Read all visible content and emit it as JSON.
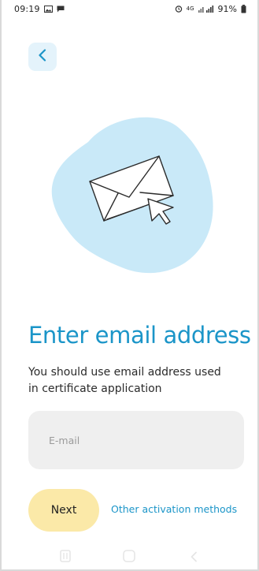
{
  "status_bar": {
    "time": "09:19",
    "battery": "91%",
    "network": "4G",
    "icons": [
      "image-icon",
      "message-icon",
      "alarm-icon",
      "signal-icon",
      "battery-icon"
    ]
  },
  "header": {
    "back_icon": "chevron-left-icon"
  },
  "illustration": {
    "name": "envelope-with-cursor",
    "blob_color": "#c9e9f8",
    "stroke_color": "#2b2b2b"
  },
  "main": {
    "title": "Enter email address",
    "subtitle": "You should use email address used in certificate application"
  },
  "form": {
    "email": {
      "placeholder": "E-mail",
      "value": ""
    }
  },
  "actions": {
    "next_label": "Next",
    "other_methods_label": "Other activation methods"
  },
  "nav_bar": {
    "icons": [
      "recents-icon",
      "home-icon",
      "back-icon"
    ]
  },
  "colors": {
    "accent": "#1b95c8",
    "back_button_bg": "#e4f3fb",
    "next_button_bg": "#fbe9a8",
    "input_bg": "#efefef"
  }
}
